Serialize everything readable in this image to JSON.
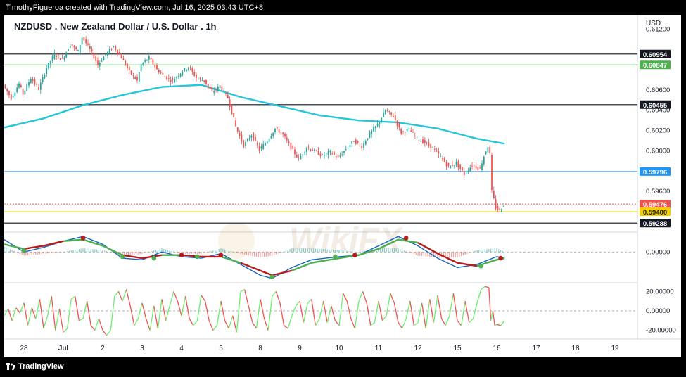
{
  "header": {
    "attribution": "TimothyFigueroa created with TradingView.com, Jul 16, 2025 03:43 UTC+8"
  },
  "footer": {
    "logo_text": "TradingView",
    "logo_icon": "tradingview-logo-icon"
  },
  "colors": {
    "candle_up": "#26a69a",
    "candle_down": "#ef5350",
    "ma200": "#26c6da",
    "macd_line": "#1565c0",
    "macd_signal_up": "#4caf50",
    "macd_signal_down": "#b71c1c",
    "osc_up": "#69f06b",
    "osc_down": "#ef5350",
    "level_blue": "#2196f3",
    "level_green": "#4caf50",
    "level_yellow": "#f2d000",
    "level_black": "#131722"
  },
  "chart_data": {
    "type": "candlestick",
    "title": "NZDUSD . New Zealand Dollar / U.S. Dollar . 1h",
    "currency": "USD",
    "timeframe": "1h",
    "price_axis": {
      "range": [
        0.5922,
        0.6132
      ],
      "tick_labels": [
        "0.61200",
        "0.60600",
        "0.60400",
        "0.60200",
        "0.60000",
        "0.59600"
      ],
      "tick_values": [
        0.612,
        0.606,
        0.604,
        0.602,
        0.6,
        0.596
      ]
    },
    "x_axis": {
      "tick_labels": [
        "28",
        "Jul",
        "2",
        "3",
        "4",
        "5",
        "8",
        "9",
        "10",
        "11",
        "12",
        "15",
        "16",
        "17",
        "18",
        "19"
      ],
      "tick_index": [
        0,
        1,
        2,
        3,
        4,
        5,
        6,
        7,
        8,
        9,
        10,
        11,
        12,
        13,
        14,
        15
      ]
    },
    "horizontal_levels": [
      {
        "label": "0.60954",
        "value": 0.60954,
        "style": "solid",
        "color": "black",
        "tag_bg": "black"
      },
      {
        "label": "0.60847",
        "value": 0.60847,
        "style": "solid",
        "color": "green",
        "tag_bg": "green"
      },
      {
        "label": "0.60455",
        "value": 0.60455,
        "style": "solid",
        "color": "black",
        "tag_bg": "black"
      },
      {
        "label": "0.59796",
        "value": 0.59796,
        "style": "solid",
        "color": "blue",
        "tag_bg": "blue"
      },
      {
        "label": "0.59476",
        "value": 0.59476,
        "style": "dotted",
        "color": "red",
        "tag_bg": "red"
      },
      {
        "label": "0.59400",
        "value": 0.594,
        "style": "solid",
        "color": "yellow",
        "tag_bg": "yellow"
      },
      {
        "label": "0.59288",
        "value": 0.59288,
        "style": "solid",
        "color": "black",
        "tag_bg": "black"
      }
    ],
    "price_path": [
      [
        -0.5,
        0.6065
      ],
      [
        -0.3,
        0.6052
      ],
      [
        -0.1,
        0.6066
      ],
      [
        0.0,
        0.6056
      ],
      [
        0.2,
        0.6072
      ],
      [
        0.4,
        0.6061
      ],
      [
        0.6,
        0.6082
      ],
      [
        0.8,
        0.6095
      ],
      [
        1.0,
        0.609
      ],
      [
        1.2,
        0.6105
      ],
      [
        1.4,
        0.6098
      ],
      [
        1.5,
        0.6112
      ],
      [
        1.7,
        0.61
      ],
      [
        1.9,
        0.6085
      ],
      [
        2.1,
        0.6095
      ],
      [
        2.3,
        0.6103
      ],
      [
        2.5,
        0.6092
      ],
      [
        2.7,
        0.6078
      ],
      [
        2.9,
        0.6069
      ],
      [
        3.0,
        0.6085
      ],
      [
        3.2,
        0.6092
      ],
      [
        3.4,
        0.608
      ],
      [
        3.6,
        0.6073
      ],
      [
        3.8,
        0.6069
      ],
      [
        4.0,
        0.6077
      ],
      [
        4.2,
        0.6083
      ],
      [
        4.4,
        0.6072
      ],
      [
        4.6,
        0.6069
      ],
      [
        4.8,
        0.6058
      ],
      [
        5.0,
        0.6064
      ],
      [
        5.2,
        0.6052
      ],
      [
        5.4,
        0.6024
      ],
      [
        5.6,
        0.6005
      ],
      [
        5.8,
        0.6016
      ],
      [
        6.0,
        0.6001
      ],
      [
        6.2,
        0.601
      ],
      [
        6.4,
        0.6022
      ],
      [
        6.6,
        0.6016
      ],
      [
        6.8,
        0.6003
      ],
      [
        7.0,
        0.5992
      ],
      [
        7.2,
        0.6003
      ],
      [
        7.4,
        0.6
      ],
      [
        7.6,
        0.5995
      ],
      [
        7.8,
        0.5999
      ],
      [
        8.0,
        0.5993
      ],
      [
        8.2,
        0.6002
      ],
      [
        8.4,
        0.601
      ],
      [
        8.6,
        0.6004
      ],
      [
        8.8,
        0.6017
      ],
      [
        9.0,
        0.6026
      ],
      [
        9.2,
        0.604
      ],
      [
        9.4,
        0.6034
      ],
      [
        9.6,
        0.6018
      ],
      [
        9.8,
        0.6021
      ],
      [
        10.0,
        0.6012
      ],
      [
        10.2,
        0.6008
      ],
      [
        10.4,
        0.6003
      ],
      [
        10.6,
        0.5994
      ],
      [
        10.8,
        0.5984
      ],
      [
        11.0,
        0.5988
      ],
      [
        11.2,
        0.5977
      ],
      [
        11.4,
        0.5986
      ],
      [
        11.6,
        0.5982
      ],
      [
        11.7,
        0.5995
      ],
      [
        11.8,
        0.6005
      ],
      [
        11.85,
        0.5997
      ],
      [
        11.9,
        0.596
      ],
      [
        12.0,
        0.5944
      ],
      [
        12.1,
        0.5941
      ],
      [
        12.15,
        0.5944
      ],
      [
        12.2,
        0.5947
      ]
    ],
    "ma200": [
      [
        -0.5,
        0.6023
      ],
      [
        0.5,
        0.6032
      ],
      [
        1.5,
        0.6045
      ],
      [
        2.5,
        0.6055
      ],
      [
        3.5,
        0.6063
      ],
      [
        4.5,
        0.6065
      ],
      [
        5.5,
        0.6053
      ],
      [
        6.5,
        0.6044
      ],
      [
        7.5,
        0.6035
      ],
      [
        8.5,
        0.603
      ],
      [
        9.5,
        0.6028
      ],
      [
        10.5,
        0.6022
      ],
      [
        11.5,
        0.6012
      ],
      [
        12.2,
        0.6007
      ]
    ],
    "macd_panel": {
      "axis_labels": [
        "0.00000"
      ],
      "axis_values": [
        0
      ],
      "range": [
        -0.0018,
        0.0011
      ],
      "macd_line": [
        [
          -0.5,
          0.0008
        ],
        [
          0.0,
          0.0
        ],
        [
          0.5,
          0.0003
        ],
        [
          1.0,
          0.0007
        ],
        [
          1.5,
          0.001
        ],
        [
          2.0,
          0.0005
        ],
        [
          2.5,
          -0.0004
        ],
        [
          3.0,
          -0.0005
        ],
        [
          3.5,
          0.0
        ],
        [
          4.0,
          -0.0003
        ],
        [
          4.5,
          -0.0004
        ],
        [
          5.0,
          -0.0001
        ],
        [
          5.5,
          -0.0008
        ],
        [
          6.0,
          -0.0015
        ],
        [
          6.3,
          -0.0017
        ],
        [
          6.8,
          -0.001
        ],
        [
          7.3,
          -0.0005
        ],
        [
          8.0,
          -0.0003
        ],
        [
          8.5,
          -0.0002
        ],
        [
          9.0,
          0.0004
        ],
        [
          9.5,
          0.001
        ],
        [
          10.0,
          0.0004
        ],
        [
          10.5,
          -0.0004
        ],
        [
          11.0,
          -0.001
        ],
        [
          11.5,
          -0.0008
        ],
        [
          12.0,
          -0.0003
        ],
        [
          12.2,
          -0.0004
        ]
      ],
      "signal_line": [
        [
          -0.5,
          0.0005
        ],
        [
          0.0,
          0.0002
        ],
        [
          0.5,
          0.0004
        ],
        [
          1.0,
          0.0007
        ],
        [
          1.5,
          0.0008
        ],
        [
          2.0,
          0.0004
        ],
        [
          2.5,
          -0.0002
        ],
        [
          3.0,
          -0.0004
        ],
        [
          3.5,
          -0.0002
        ],
        [
          4.0,
          -0.0002
        ],
        [
          4.5,
          -0.0003
        ],
        [
          5.0,
          -0.0003
        ],
        [
          5.5,
          -0.0007
        ],
        [
          6.0,
          -0.0012
        ],
        [
          6.3,
          -0.0015
        ],
        [
          6.8,
          -0.0012
        ],
        [
          7.3,
          -0.0007
        ],
        [
          8.0,
          -0.0004
        ],
        [
          8.5,
          -0.0002
        ],
        [
          9.0,
          0.0002
        ],
        [
          9.5,
          0.0008
        ],
        [
          10.0,
          0.0006
        ],
        [
          10.5,
          -0.0001
        ],
        [
          11.0,
          -0.0007
        ],
        [
          11.5,
          -0.0009
        ],
        [
          12.0,
          -0.0005
        ],
        [
          12.2,
          -0.0004
        ]
      ],
      "cross_points": [
        [
          0.0,
          0.0001,
          "up"
        ],
        [
          1.5,
          0.0009,
          "down"
        ],
        [
          2.5,
          -0.0003,
          "up"
        ],
        [
          3.3,
          -0.0004,
          "up"
        ],
        [
          4.0,
          -0.0002,
          "down"
        ],
        [
          4.4,
          -0.0003,
          "up"
        ],
        [
          5.0,
          -0.0002,
          "down"
        ],
        [
          6.3,
          -0.0016,
          "up"
        ],
        [
          7.9,
          -0.0003,
          "up"
        ],
        [
          8.4,
          -0.0002,
          "down"
        ],
        [
          9.7,
          0.0009,
          "down"
        ],
        [
          11.6,
          -0.0009,
          "up"
        ],
        [
          12.1,
          -0.0004,
          "down"
        ]
      ]
    },
    "oscillator_panel": {
      "axis_labels": [
        "20.00000",
        "0.00000",
        "-20.00000"
      ],
      "axis_values": [
        20,
        0,
        -20
      ],
      "range": [
        -26,
        26
      ],
      "values": [
        [
          -0.5,
          -5
        ],
        [
          -0.4,
          2
        ],
        [
          -0.3,
          -10
        ],
        [
          -0.2,
          3
        ],
        [
          -0.1,
          -2
        ],
        [
          0.0,
          8
        ],
        [
          0.1,
          -15
        ],
        [
          0.2,
          3
        ],
        [
          0.3,
          -8
        ],
        [
          0.4,
          12
        ],
        [
          0.5,
          -18
        ],
        [
          0.6,
          -5
        ],
        [
          0.7,
          15
        ],
        [
          0.8,
          -20
        ],
        [
          0.9,
          2
        ],
        [
          1.0,
          -22
        ],
        [
          1.1,
          -18
        ],
        [
          1.2,
          12
        ],
        [
          1.3,
          15
        ],
        [
          1.4,
          -10
        ],
        [
          1.5,
          -8
        ],
        [
          1.6,
          10
        ],
        [
          1.7,
          -15
        ],
        [
          1.8,
          -20
        ],
        [
          1.9,
          -8
        ],
        [
          2.0,
          -20
        ],
        [
          2.1,
          -25
        ],
        [
          2.2,
          -20
        ],
        [
          2.3,
          15
        ],
        [
          2.4,
          20
        ],
        [
          2.5,
          10
        ],
        [
          2.6,
          22
        ],
        [
          2.7,
          5
        ],
        [
          2.8,
          -15
        ],
        [
          2.9,
          -8
        ],
        [
          3.0,
          8
        ],
        [
          3.1,
          -8
        ],
        [
          3.2,
          -20
        ],
        [
          3.3,
          5
        ],
        [
          3.4,
          -18
        ],
        [
          3.5,
          12
        ],
        [
          3.6,
          -10
        ],
        [
          3.7,
          5
        ],
        [
          3.8,
          20
        ],
        [
          3.9,
          10
        ],
        [
          4.0,
          -5
        ],
        [
          4.1,
          15
        ],
        [
          4.2,
          -8
        ],
        [
          4.3,
          -15
        ],
        [
          4.4,
          -10
        ],
        [
          4.5,
          16
        ],
        [
          4.6,
          10
        ],
        [
          4.7,
          -10
        ],
        [
          4.8,
          -20
        ],
        [
          4.9,
          -15
        ],
        [
          5.0,
          10
        ],
        [
          5.1,
          -10
        ],
        [
          5.2,
          -18
        ],
        [
          5.3,
          -5
        ],
        [
          5.4,
          -22
        ],
        [
          5.5,
          20
        ],
        [
          5.6,
          22
        ],
        [
          5.7,
          5
        ],
        [
          5.8,
          -12
        ],
        [
          5.9,
          -18
        ],
        [
          6.0,
          12
        ],
        [
          6.1,
          -8
        ],
        [
          6.2,
          -20
        ],
        [
          6.3,
          15
        ],
        [
          6.4,
          20
        ],
        [
          6.5,
          8
        ],
        [
          6.6,
          -15
        ],
        [
          6.7,
          -18
        ],
        [
          6.8,
          -5
        ],
        [
          6.9,
          5
        ],
        [
          7.0,
          10
        ],
        [
          7.1,
          -12
        ],
        [
          7.2,
          8
        ],
        [
          7.3,
          12
        ],
        [
          7.4,
          -15
        ],
        [
          7.5,
          -8
        ],
        [
          7.6,
          10
        ],
        [
          7.7,
          -12
        ],
        [
          7.8,
          5
        ],
        [
          7.9,
          -10
        ],
        [
          8.0,
          -15
        ],
        [
          8.1,
          18
        ],
        [
          8.2,
          10
        ],
        [
          8.3,
          -8
        ],
        [
          8.4,
          -18
        ],
        [
          8.5,
          10
        ],
        [
          8.6,
          20
        ],
        [
          8.7,
          8
        ],
        [
          8.8,
          -15
        ],
        [
          8.9,
          -12
        ],
        [
          9.0,
          10
        ],
        [
          9.1,
          -10
        ],
        [
          9.2,
          -5
        ],
        [
          9.3,
          18
        ],
        [
          9.4,
          8
        ],
        [
          9.5,
          -12
        ],
        [
          9.6,
          -18
        ],
        [
          9.7,
          -8
        ],
        [
          9.8,
          10
        ],
        [
          9.9,
          -15
        ],
        [
          10.0,
          -12
        ],
        [
          10.1,
          8
        ],
        [
          10.2,
          -18
        ],
        [
          10.3,
          12
        ],
        [
          10.4,
          -12
        ],
        [
          10.5,
          16
        ],
        [
          10.6,
          -8
        ],
        [
          10.7,
          -15
        ],
        [
          10.8,
          -5
        ],
        [
          10.9,
          18
        ],
        [
          11.0,
          -10
        ],
        [
          11.1,
          -15
        ],
        [
          11.2,
          10
        ],
        [
          11.3,
          -12
        ],
        [
          11.4,
          -8
        ],
        [
          11.5,
          8
        ],
        [
          11.6,
          22
        ],
        [
          11.7,
          25
        ],
        [
          11.8,
          24
        ],
        [
          11.85,
          -10
        ],
        [
          11.9,
          0
        ],
        [
          11.95,
          -15
        ],
        [
          12.0,
          -14
        ],
        [
          12.1,
          -15
        ],
        [
          12.2,
          -10
        ]
      ]
    }
  }
}
